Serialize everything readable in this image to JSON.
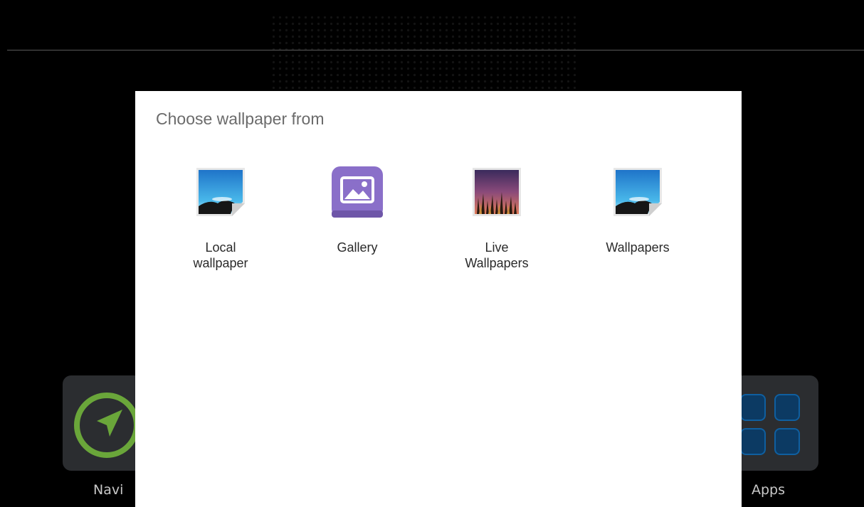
{
  "dialog": {
    "title": "Choose wallpaper from",
    "options": [
      {
        "label": "Local\nwallpaper",
        "icon": "landscape-picture-icon"
      },
      {
        "label": "Gallery",
        "icon": "gallery-icon"
      },
      {
        "label": "Live\nWallpapers",
        "icon": "live-wallpaper-icon"
      },
      {
        "label": "Wallpapers",
        "icon": "landscape-picture-icon"
      }
    ]
  },
  "home": {
    "navi_label": "Navi",
    "apps_label": "Apps"
  },
  "colors": {
    "gallery_purple": "#8a6fc9",
    "navi_green": "#6aa63a",
    "apps_blue": "#0f5fa0"
  }
}
